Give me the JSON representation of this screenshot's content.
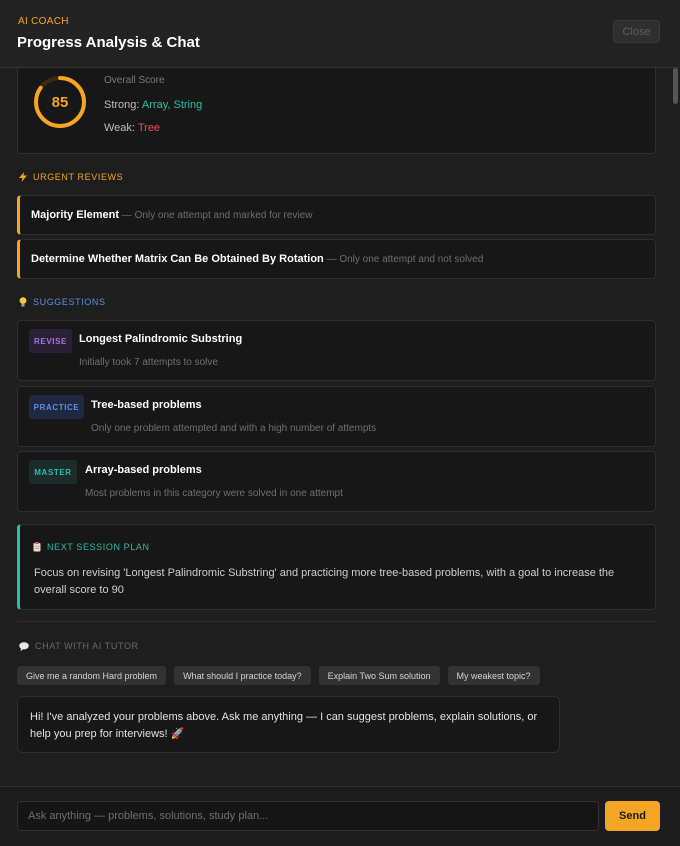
{
  "header": {
    "kicker": "AI COACH",
    "title": "Progress Analysis & Chat",
    "close_label": "Close"
  },
  "score": {
    "value": 85,
    "value_fraction": 0.85,
    "label": "Overall Score",
    "strong_label": "Strong:",
    "strong_topics": "Array, String",
    "weak_label": "Weak:",
    "weak_topics": "Tree"
  },
  "urgent": {
    "heading": "URGENT REVIEWS",
    "items": [
      {
        "title": "Majority Element",
        "note": " — Only one attempt and marked for review"
      },
      {
        "title": "Determine Whether Matrix Can Be Obtained By Rotation",
        "note": " — Only one attempt and not solved"
      }
    ]
  },
  "suggestions": {
    "heading": "SUGGESTIONS",
    "items": [
      {
        "badge": "REVISE",
        "title": "Longest Palindromic Substring",
        "note": "Initially took 7 attempts to solve"
      },
      {
        "badge": "PRACTICE",
        "title": "Tree-based problems",
        "note": "Only one problem attempted and with a high number of attempts"
      },
      {
        "badge": "MASTER",
        "title": "Array-based problems",
        "note": "Most problems in this category were solved in one attempt"
      }
    ]
  },
  "plan": {
    "heading": "NEXT SESSION PLAN",
    "text": "Focus on revising 'Longest Palindromic Substring' and practicing more tree-based problems, with a goal to increase the overall score to 90"
  },
  "chat": {
    "heading": "CHAT WITH AI TUTOR",
    "quick_prompts": [
      "Give me a random Hard problem",
      "What should I practice today?",
      "Explain Two Sum solution",
      "My weakest topic?"
    ],
    "message": "Hi! I've analyzed your problems above. Ask me anything — I can suggest problems, explain solutions, or help you prep for interviews! 🚀",
    "input_placeholder": "Ask anything — problems, solutions, study plan...",
    "send_label": "Send"
  },
  "colors": {
    "accent": "#f5a524",
    "teal": "#2bbfa4",
    "red": "#ef4d5f",
    "purple": "#a775e6",
    "blue": "#5b8fe8"
  }
}
